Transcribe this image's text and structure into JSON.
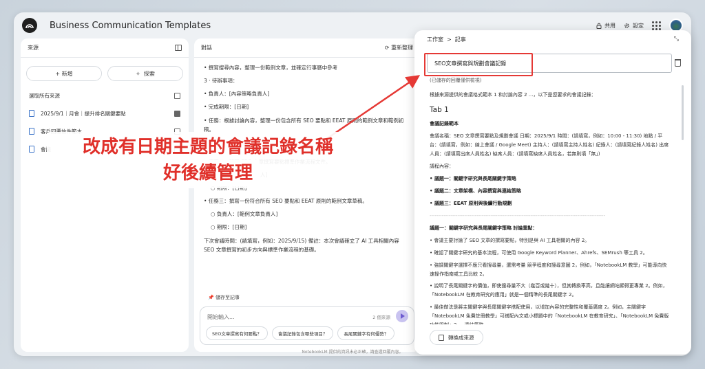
{
  "app": {
    "title": "Business Communication Templates"
  },
  "topbar": {
    "share_label": "共用",
    "settings_label": "設定"
  },
  "sources": {
    "header": "來源",
    "add_label": "+ 新增",
    "explore_label": "探索",
    "select_all": "選取所有來源",
    "items": [
      {
        "label": "2025/9/1｜月會｜提升排名關鍵要點",
        "checked": true
      },
      {
        "label": "客戶回覆信件範本",
        "checked": false
      },
      {
        "label": "會議",
        "checked": false
      }
    ]
  },
  "chat": {
    "header": "對話",
    "refresh_label": "重新整理",
    "lines": [
      "• 撰寫搜尋內容，整理一份範例文章，並確定行事曆中參考",
      "3  · 待辦事項：",
      "• 負責人：[內容策略負責人]",
      "• 完成期限：[日期]",
      "• 任務：根據討論內容，整理一份包含所有 SEO 要點和 EEAT 原則的範例文章和範例初稿。",
      "• 任務二：整理 SEO 文章撰寫要點標準作業流程文件。",
      "○ 負責人：[內容負責人]",
      "○ 期限：[日期]",
      "• 任務三：撰寫一份符合所有 SEO 要點和 EEAT 原則的範例文章草稿。",
      "○ 負責人：[範例文章負責人]",
      "○ 期限：[日期]",
      "下次會議時間：(請填寫，例如：2025/9/15) 備註：本次會議確立了 AI 工具相關內容 SEO 文章撰寫的初步方向與標準作業流程的基礎。"
    ],
    "save_note": "儲存至記事",
    "input_placeholder": "開始輸入...",
    "source_count": "2 個來源",
    "suggestions": [
      "SEO文章撰寫有何要點？",
      "會議記錄包含哪些項目？",
      "長尾關鍵字有何優勢？"
    ],
    "footer": "NotebookLM 提供的資訊未必正確，請查證回覆內容。"
  },
  "studio": {
    "breadcrumb_root": "工作室",
    "breadcrumb_sep": ">",
    "breadcrumb_leaf": "記事",
    "note_title": "SEO文章撰寫與規劃會議記錄",
    "saved_note": "(已儲存的回覆僅供檢視)",
    "intro": "根據來源提供的會議格式範本 1 和討論內容 2 ...，以下是您要求的會議記錄：",
    "tab_title": "Tab 1",
    "template_heading": "會議記錄範本",
    "meeting_info": "會議名稱：SEO 文章撰寫要點及規劃會議 日期：2025/9/1 時間：(請填寫，例如：10:00 - 11:30) 地點 / 平台：(請填寫，例如：線上會議 / Google Meet) 主持人：(請填寫主持人姓名) 紀錄人：(請填寫紀錄人姓名) 出席人員：(請填寫出席人員姓名) 缺席人員：(請填寫缺席人員姓名，若無則填「無」)",
    "agenda_label": "議程內容：",
    "agenda": [
      "• 議題一：關鍵字研究與長尾關鍵字策略",
      "• 議題二：文章架構、內容撰寫與連結策略",
      "• 議題三：EEAT 原則與後續行動規劃"
    ],
    "divider": "-----------------------------------------------------------------------------------------------------",
    "topic1_heading": "議題一：關鍵字研究與長尾關鍵字策略 討論重點：",
    "bullets": [
      "• 會議主要討論了 SEO 文章的撰寫要點，特別是與 AI 工具相關的內容 2。",
      "• 確認了關鍵字研究的基本流程，可使用 Google Keyword Planner、Ahrefs、SEMrush 等工具 2。",
      "• 強調關鍵字選擇不應只看搜尋量，還需考量 競爭程度和搜尋意圖 2，例如，「NotebookLM 教學」可能導向快速操作指南或工具比較 2。",
      "• 說明了長尾關鍵字的價值，即使搜尋量不大（幾百或幾十），但其轉換率高，且能讓網站顯得更專業 2。例如，「NotebookLM 在教育研究的應用」就是一個精準的長尾關鍵字 2。",
      "• 最佳做法是將主關鍵字與長尾關鍵字搭配使用，以增加內容的完整性和覆蓋廣度 2。例如，主關鍵字「NotebookLM 免費註冊教學」可搭配內文或小標題中的「NotebookLM 在教育研究」、「NotebookLM 免費版功能限制」2 ... 連結策略。"
    ],
    "convert_label": "轉換成來源"
  },
  "callout": {
    "line1": "改成有日期主題的會議記錄名稱",
    "line2": "好後續管理"
  },
  "colors": {
    "accent_red": "#e0302a",
    "box_red": "#e53935"
  }
}
